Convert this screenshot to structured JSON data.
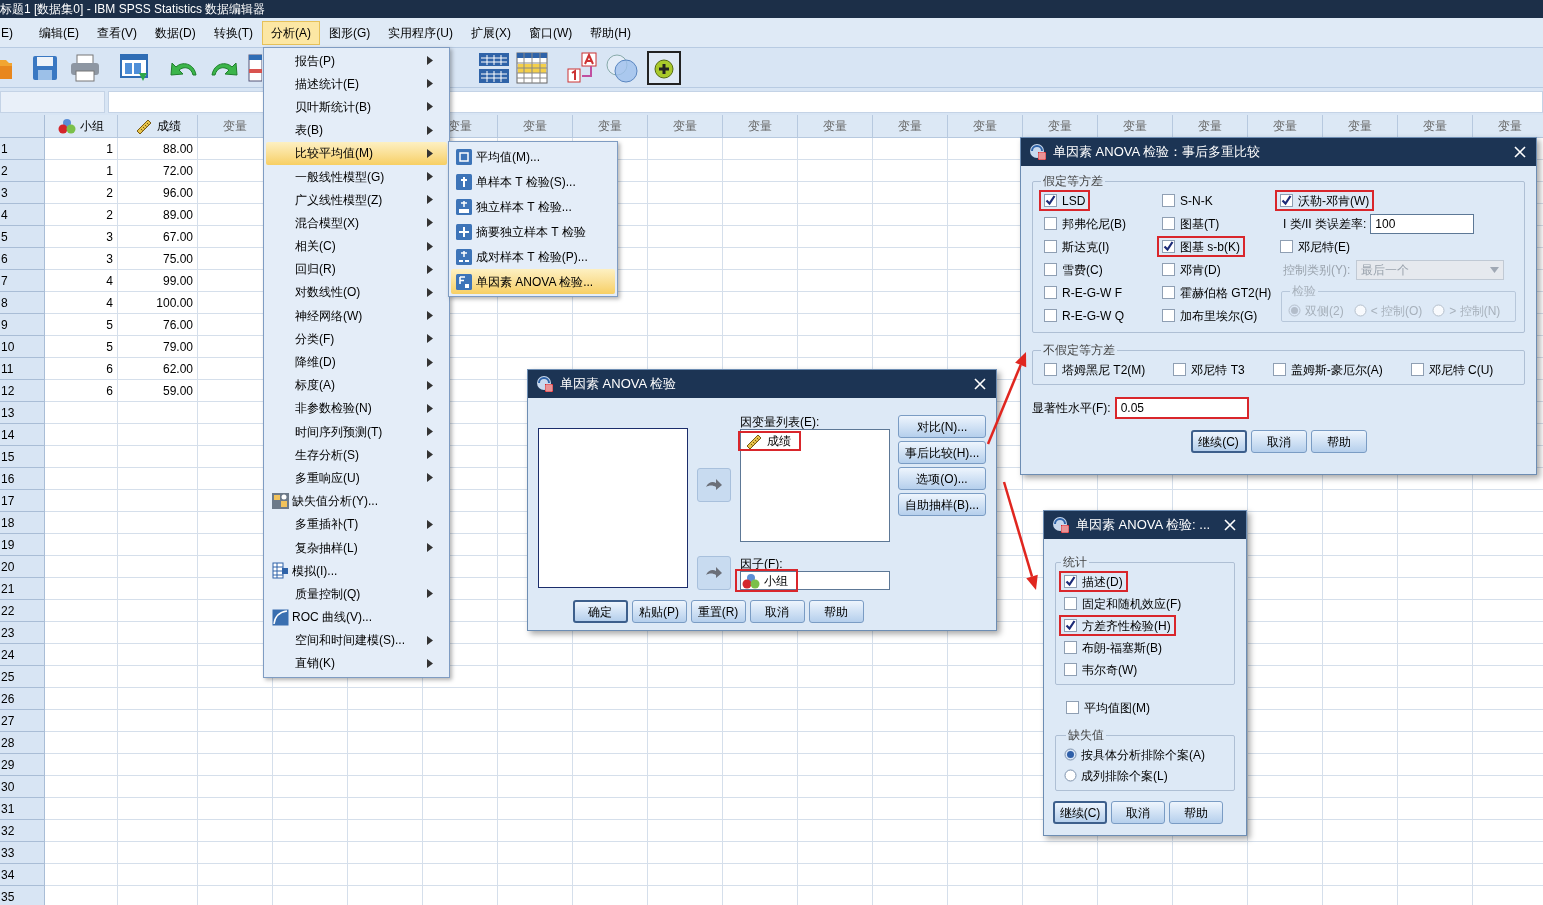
{
  "window": {
    "title": "标题1 [数据集0] - IBM SPSS Statistics 数据编辑器"
  },
  "menu_bar": [
    {
      "label": "E)",
      "selected": false
    },
    {
      "label": "编辑(E)",
      "selected": false
    },
    {
      "label": "查看(V)",
      "selected": false
    },
    {
      "label": "数据(D)",
      "selected": false
    },
    {
      "label": "转换(T)",
      "selected": false
    },
    {
      "label": "分析(A)",
      "selected": true
    },
    {
      "label": "图形(G)",
      "selected": false
    },
    {
      "label": "实用程序(U)",
      "selected": false
    },
    {
      "label": "扩展(X)",
      "selected": false
    },
    {
      "label": "窗口(W)",
      "selected": false
    },
    {
      "label": "帮助(H)",
      "selected": false
    }
  ],
  "grid": {
    "columns": [
      {
        "label": "小组",
        "kind": "nominal"
      },
      {
        "label": "成绩",
        "kind": "scale"
      },
      {
        "label": "变量",
        "kind": "variable"
      },
      {
        "label": "变量",
        "kind": "variable"
      },
      {
        "label": "变量",
        "kind": "variable"
      },
      {
        "label": "变量",
        "kind": "variable"
      },
      {
        "label": "变量",
        "kind": "variable"
      },
      {
        "label": "变量",
        "kind": "variable"
      },
      {
        "label": "变量",
        "kind": "variable"
      },
      {
        "label": "变量",
        "kind": "variable"
      },
      {
        "label": "变量",
        "kind": "variable"
      },
      {
        "label": "变量",
        "kind": "variable"
      },
      {
        "label": "变量",
        "kind": "variable"
      },
      {
        "label": "变量",
        "kind": "variable"
      },
      {
        "label": "变量",
        "kind": "variable"
      },
      {
        "label": "变量",
        "kind": "variable"
      },
      {
        "label": "变量",
        "kind": "variable"
      },
      {
        "label": "变量",
        "kind": "variable"
      }
    ],
    "rows": [
      {
        "number": "1",
        "cells": [
          "1",
          "88.00"
        ]
      },
      {
        "number": "2",
        "cells": [
          "1",
          "72.00"
        ]
      },
      {
        "number": "3",
        "cells": [
          "2",
          "96.00"
        ]
      },
      {
        "number": "4",
        "cells": [
          "2",
          "89.00"
        ]
      },
      {
        "number": "5",
        "cells": [
          "3",
          "67.00"
        ]
      },
      {
        "number": "6",
        "cells": [
          "3",
          "75.00"
        ]
      },
      {
        "number": "7",
        "cells": [
          "4",
          "99.00"
        ]
      },
      {
        "number": "8",
        "cells": [
          "4",
          "100.00"
        ]
      },
      {
        "number": "9",
        "cells": [
          "5",
          "76.00"
        ]
      },
      {
        "number": "10",
        "cells": [
          "5",
          "79.00"
        ]
      },
      {
        "number": "11",
        "cells": [
          "6",
          "62.00"
        ]
      },
      {
        "number": "12",
        "cells": [
          "6",
          "59.00"
        ]
      },
      {
        "number": "13"
      },
      {
        "number": "14"
      },
      {
        "number": "15"
      },
      {
        "number": "16"
      },
      {
        "number": "17"
      },
      {
        "number": "18"
      },
      {
        "number": "19"
      },
      {
        "number": "20"
      },
      {
        "number": "21"
      },
      {
        "number": "22"
      },
      {
        "number": "23"
      },
      {
        "number": "24"
      },
      {
        "number": "25"
      },
      {
        "number": "26"
      },
      {
        "number": "27"
      },
      {
        "number": "28"
      },
      {
        "number": "29"
      },
      {
        "number": "30"
      },
      {
        "number": "31"
      },
      {
        "number": "32"
      },
      {
        "number": "33"
      },
      {
        "number": "34"
      },
      {
        "number": "35"
      }
    ]
  },
  "analyze_menu": {
    "items": [
      {
        "label": "报告(P)",
        "kind": "submenu",
        "selected": false
      },
      {
        "label": "描述统计(E)",
        "kind": "submenu",
        "selected": false
      },
      {
        "label": "贝叶斯统计(B)",
        "kind": "submenu",
        "selected": false
      },
      {
        "label": "表(B)",
        "kind": "submenu",
        "selected": false
      },
      {
        "label": "比较平均值(M)",
        "kind": "submenu",
        "selected": true
      },
      {
        "label": "一般线性模型(G)",
        "kind": "submenu",
        "selected": false
      },
      {
        "label": "广义线性模型(Z)",
        "kind": "submenu",
        "selected": false
      },
      {
        "label": "混合模型(X)",
        "kind": "submenu",
        "selected": false
      },
      {
        "label": "相关(C)",
        "kind": "submenu",
        "selected": false
      },
      {
        "label": "回归(R)",
        "kind": "submenu",
        "selected": false
      },
      {
        "label": "对数线性(O)",
        "kind": "submenu",
        "selected": false
      },
      {
        "label": "神经网络(W)",
        "kind": "submenu",
        "selected": false
      },
      {
        "label": "分类(F)",
        "kind": "submenu",
        "selected": false
      },
      {
        "label": "降维(D)",
        "kind": "submenu",
        "selected": false
      },
      {
        "label": "标度(A)",
        "kind": "submenu",
        "selected": false
      },
      {
        "label": "非参数检验(N)",
        "kind": "submenu",
        "selected": false
      },
      {
        "label": "时间序列预测(T)",
        "kind": "submenu",
        "selected": false
      },
      {
        "label": "生存分析(S)",
        "kind": "submenu",
        "selected": false
      },
      {
        "label": "多重响应(U)",
        "kind": "submenu",
        "selected": false
      },
      {
        "label": "缺失值分析(Y)...",
        "kind": "missing-values",
        "selected": false
      },
      {
        "label": "多重插补(T)",
        "kind": "submenu",
        "selected": false
      },
      {
        "label": "复杂抽样(L)",
        "kind": "submenu",
        "selected": false
      },
      {
        "label": "模拟(I)...",
        "kind": "simulation",
        "selected": false
      },
      {
        "label": "质量控制(Q)",
        "kind": "submenu",
        "selected": false
      },
      {
        "label": "ROC 曲线(V)...",
        "kind": "roc-curve",
        "selected": false
      },
      {
        "label": "空间和时间建模(S)...",
        "kind": "submenu",
        "selected": false
      },
      {
        "label": "直销(K)",
        "kind": "submenu",
        "selected": false
      }
    ]
  },
  "compare_means_menu": {
    "items": [
      {
        "label": "平均值(M)...",
        "kind": "means",
        "selected": false
      },
      {
        "label": "单样本 T 检验(S)...",
        "kind": "one-sample",
        "selected": false
      },
      {
        "label": "独立样本 T 检验...",
        "kind": "independent",
        "selected": false
      },
      {
        "label": "摘要独立样本 T 检验",
        "kind": "summary",
        "selected": false
      },
      {
        "label": "成对样本 T 检验(P)...",
        "kind": "paired",
        "selected": false
      },
      {
        "label": "单因素 ANOVA 检验...",
        "kind": "anova",
        "selected": true
      }
    ]
  },
  "anova_dialog": {
    "title": "单因素 ANOVA 检验",
    "dependent_list": {
      "label": "因变量列表(E):",
      "items": [
        {
          "label": "成绩",
          "kind": "scale",
          "highlighted": true
        }
      ]
    },
    "factor": {
      "label": "因子(F):",
      "value": {
        "label": "小组",
        "kind": "nominal",
        "highlighted": true
      }
    },
    "side_buttons": [
      {
        "label": "对比(N)..."
      },
      {
        "label": "事后比较(H)..."
      },
      {
        "label": "选项(O)..."
      },
      {
        "label": "自助抽样(B)..."
      }
    ],
    "buttons": [
      {
        "label": "确定",
        "default": true
      },
      {
        "label": "粘贴(P)",
        "default": false
      },
      {
        "label": "重置(R)",
        "default": false
      },
      {
        "label": "取消",
        "default": false
      },
      {
        "label": "帮助",
        "default": false
      }
    ]
  },
  "posthoc_dialog": {
    "title": "单因素 ANOVA 检验：事后多重比较",
    "equal_variances": {
      "label": "假定等方差",
      "options": [
        {
          "label": "LSD",
          "checked": true,
          "highlighted": true
        },
        {
          "label": "邦弗伦尼(B)",
          "checked": false,
          "highlighted": false
        },
        {
          "label": "斯达克(I)",
          "checked": false,
          "highlighted": false
        },
        {
          "label": "雪费(C)",
          "checked": false,
          "highlighted": false
        },
        {
          "label": "R-E-G-W F",
          "checked": false,
          "highlighted": false
        },
        {
          "label": "R-E-G-W Q",
          "checked": false,
          "highlighted": false
        },
        {
          "label": "S-N-K",
          "checked": false,
          "highlighted": false
        },
        {
          "label": "图基(T)",
          "checked": false,
          "highlighted": false
        },
        {
          "label": "图基 s-b(K)",
          "checked": true,
          "highlighted": true
        },
        {
          "label": "邓肯(D)",
          "checked": false,
          "highlighted": false
        },
        {
          "label": "霍赫伯格 GT2(H)",
          "checked": false,
          "highlighted": false
        },
        {
          "label": "加布里埃尔(G)",
          "checked": false,
          "highlighted": false
        }
      ],
      "waller_duncan": {
        "label": "沃勒-邓肯(W)",
        "checked": true,
        "highlighted": true
      },
      "error_ratio": {
        "label": "I 类/II 类误差率:",
        "value": "100"
      },
      "dunnett": {
        "label": "邓尼特(E)",
        "checked": false,
        "highlighted": false
      },
      "control_category": {
        "label": "控制类别(Y):",
        "value": "最后一个",
        "disabled": true
      },
      "test": {
        "label": "检验",
        "disabled": true,
        "options": [
          {
            "label": "双侧(2)",
            "selected": true
          },
          {
            "label": "< 控制(O)",
            "selected": false
          },
          {
            "label": "> 控制(N)",
            "selected": false
          }
        ]
      }
    },
    "unequal_variances": {
      "label": "不假定等方差",
      "options": [
        {
          "label": "塔姆黑尼 T2(M)",
          "checked": false,
          "highlighted": false
        },
        {
          "label": "邓尼特 T3",
          "checked": false,
          "highlighted": false
        },
        {
          "label": "盖姆斯-豪厄尔(A)",
          "checked": false,
          "highlighted": false
        },
        {
          "label": "邓尼特 C(U)",
          "checked": false,
          "highlighted": false
        }
      ]
    },
    "significance": {
      "label": "显著性水平(F):",
      "value": "0.05",
      "highlighted": true
    },
    "buttons": [
      {
        "label": "继续(C)",
        "default": true
      },
      {
        "label": "取消",
        "default": false
      },
      {
        "label": "帮助",
        "default": false
      }
    ]
  },
  "options_dialog": {
    "title": "单因素 ANOVA 检验: ...",
    "statistics": {
      "label": "统计",
      "options": [
        {
          "label": "描述(D)",
          "checked": true,
          "highlighted": true
        },
        {
          "label": "固定和随机效应(F)",
          "checked": false,
          "highlighted": false
        },
        {
          "label": "方差齐性检验(H)",
          "checked": true,
          "highlighted": true
        },
        {
          "label": "布朗-福塞斯(B)",
          "checked": false,
          "highlighted": false
        },
        {
          "label": "韦尔奇(W)",
          "checked": false,
          "highlighted": false
        }
      ]
    },
    "means_plot": {
      "label": "平均值图(M)",
      "checked": false,
      "highlighted": false
    },
    "missing_values": {
      "label": "缺失值",
      "options": [
        {
          "label": "按具体分析排除个案(A)",
          "selected": true
        },
        {
          "label": "成列排除个案(L)",
          "selected": false
        }
      ]
    },
    "buttons": [
      {
        "label": "继续(C)",
        "default": true
      },
      {
        "label": "取消",
        "default": false
      },
      {
        "label": "帮助",
        "default": false
      }
    ]
  }
}
